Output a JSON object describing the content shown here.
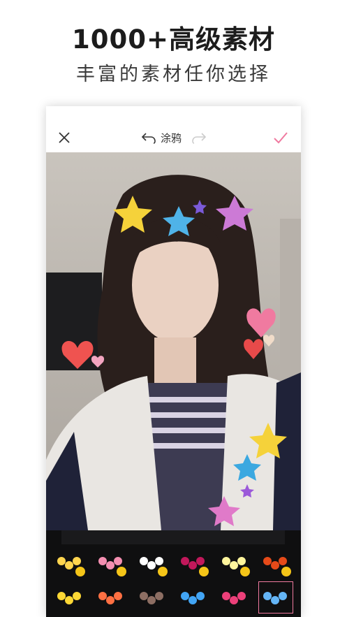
{
  "promo": {
    "headline": "1000+高级素材",
    "subline": "丰富的素材任你选择"
  },
  "editor": {
    "title": "涂鸦",
    "accent_color": "#f07aa0",
    "close_icon": "close-icon",
    "undo_icon": "undo-icon",
    "redo_icon": "redo-icon",
    "confirm_icon": "checkmark-icon"
  },
  "sticker_tray": {
    "items": [
      {
        "icon": "sparkle-stars-icon",
        "premium": true
      },
      {
        "icon": "macaron-icon",
        "premium": true
      },
      {
        "icon": "cute-faces-icon",
        "premium": true
      },
      {
        "icon": "purple-hearts-icon",
        "premium": true
      },
      {
        "icon": "flower-icon",
        "premium": true
      },
      {
        "icon": "mushroom-icon",
        "premium": true
      },
      {
        "icon": "chick-icon",
        "premium": false
      },
      {
        "icon": "fruit-icon",
        "premium": false
      },
      {
        "icon": "easter-egg-icon",
        "premium": false
      },
      {
        "icon": "rainbow-rings-icon",
        "premium": false
      },
      {
        "icon": "pink-hearts-icon",
        "premium": false
      },
      {
        "icon": "colorful-stars-icon",
        "premium": false,
        "selected": true
      }
    ]
  }
}
